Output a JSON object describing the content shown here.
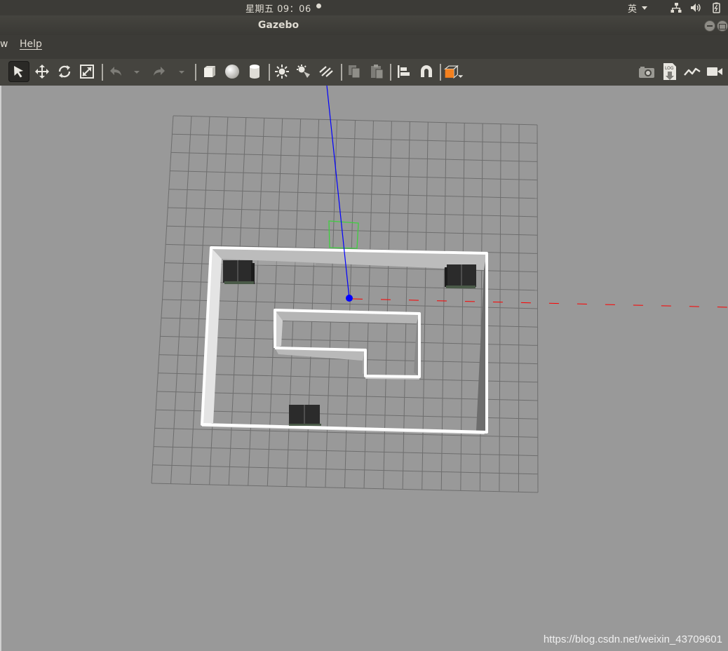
{
  "top_panel": {
    "clock": "星期五 09：06",
    "input_method": "英"
  },
  "window": {
    "title": "Gazebo"
  },
  "menu": {
    "items": [
      "w",
      "Help"
    ]
  },
  "toolbar": {
    "tools": [
      "select-mode",
      "translate-mode",
      "rotate-mode",
      "scale-mode",
      "undo",
      "redo",
      "box-shape",
      "sphere-shape",
      "cylinder-shape",
      "point-light",
      "spot-light",
      "directional-light",
      "copy",
      "paste",
      "align",
      "snap",
      "change-view",
      "screenshot",
      "log",
      "plot",
      "record-video"
    ]
  },
  "scene": {
    "ground_grid_color": "#6e6e6e",
    "wall_color": "#ffffff",
    "axis_colors": {
      "z": "#0000ff",
      "x": "#ff0000"
    }
  },
  "watermark": "https://blog.csdn.net/weixin_43709601"
}
